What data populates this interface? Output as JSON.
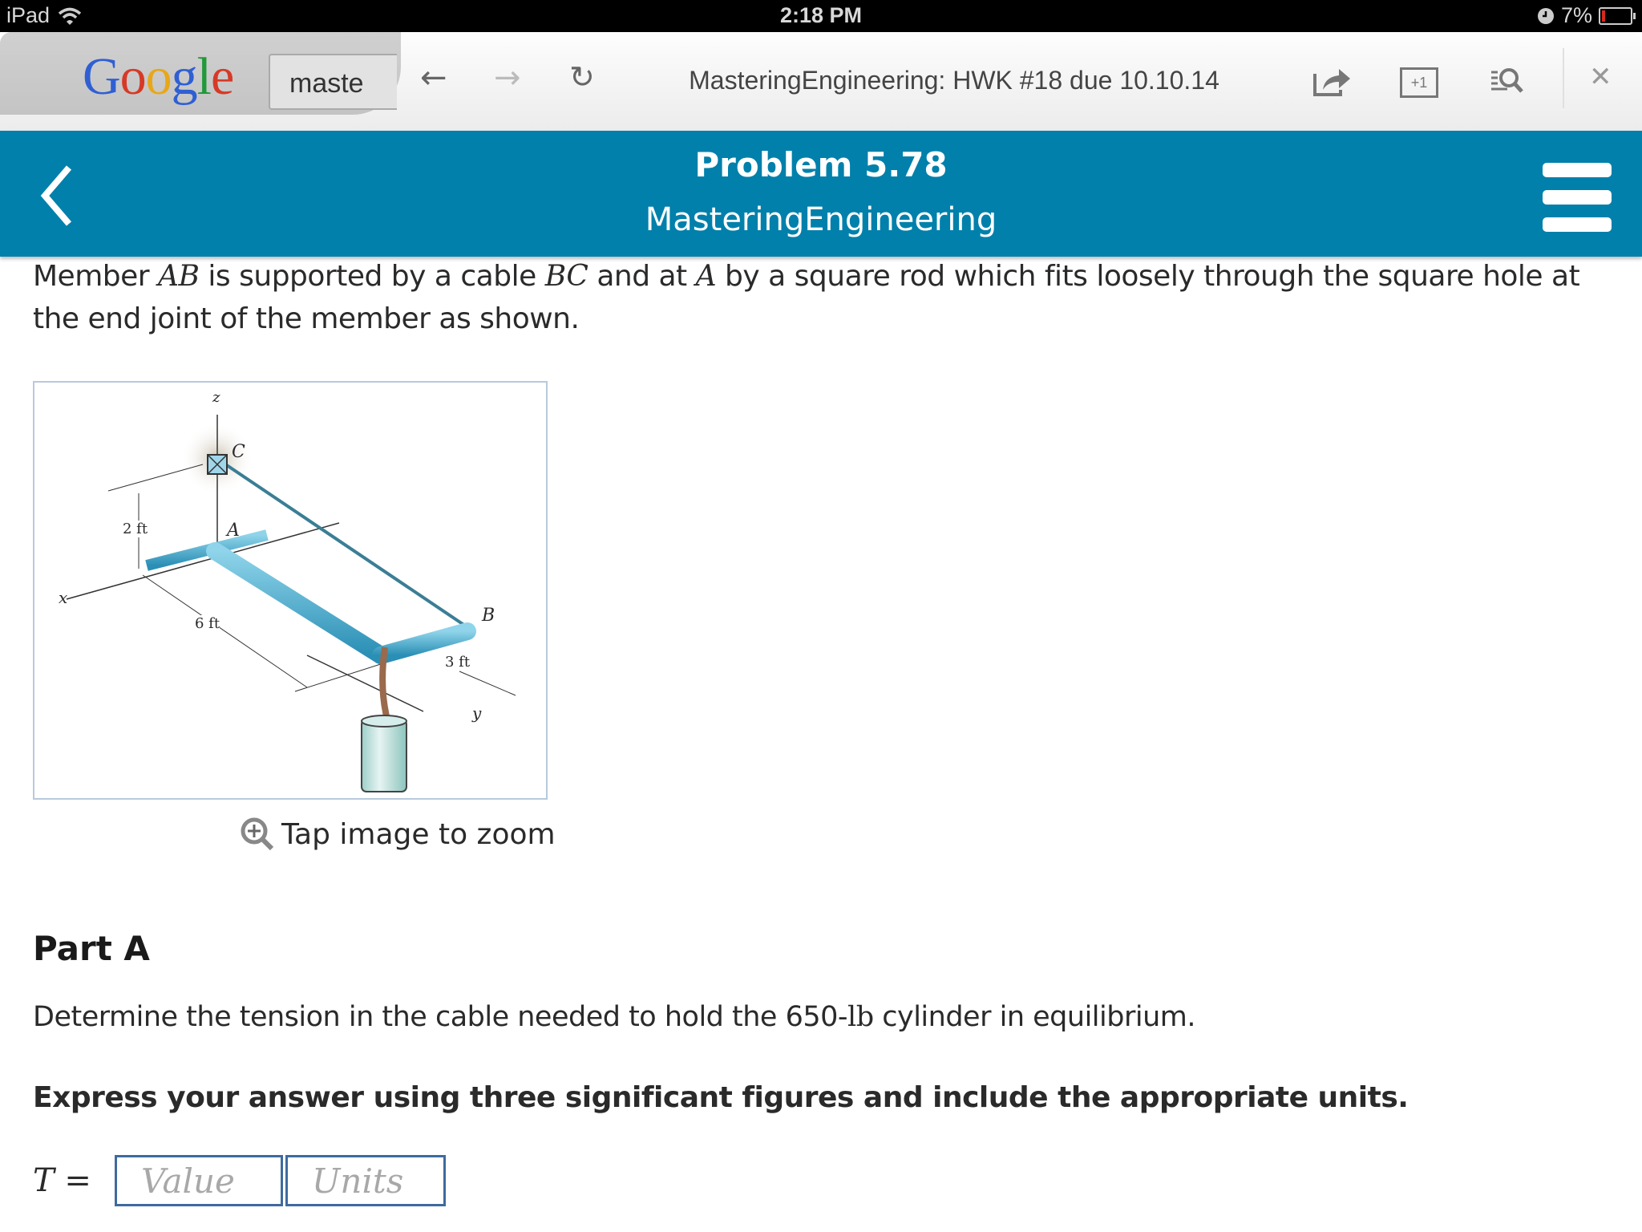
{
  "status_bar": {
    "device": "iPad",
    "time": "2:18 PM",
    "battery_percent": "7%",
    "battery_level": 0.07
  },
  "browser": {
    "logo": "Google",
    "search_value": "maste",
    "page_title": "MasteringEngineering: HWK #18 due 10.10.14",
    "plus_one_label": "+1",
    "icons": [
      "back-arrow-icon",
      "forward-arrow-icon",
      "reload-icon",
      "share-icon",
      "plus-one-icon",
      "find-in-page-icon",
      "close-icon"
    ]
  },
  "header": {
    "title": "Problem 5.78",
    "subtitle": "MasteringEngineering"
  },
  "problem": {
    "intro_parts": [
      "Member ",
      "AB",
      " is supported by a cable ",
      "BC",
      " and at ",
      "A",
      " by a square rod which fits loosely through the square hole at the end joint of the member as shown."
    ],
    "figure_labels": {
      "z": "z",
      "x": "x",
      "y": "y",
      "C": "C",
      "A": "A",
      "B": "B",
      "dim_2": "2 ft",
      "dim_6": "6 ft",
      "dim_3": "3 ft"
    },
    "zoom_hint": "Tap image to zoom"
  },
  "part_a": {
    "title": "Part A",
    "question_pre": "Determine the tension in the cable needed to hold the 650-",
    "question_unit": "lb",
    "question_post": " cylinder in equilibrium.",
    "instructions": "Express your answer using three significant figures and include the appropriate units.",
    "answer_label": "T =",
    "value_placeholder": "Value",
    "units_placeholder": "Units"
  }
}
